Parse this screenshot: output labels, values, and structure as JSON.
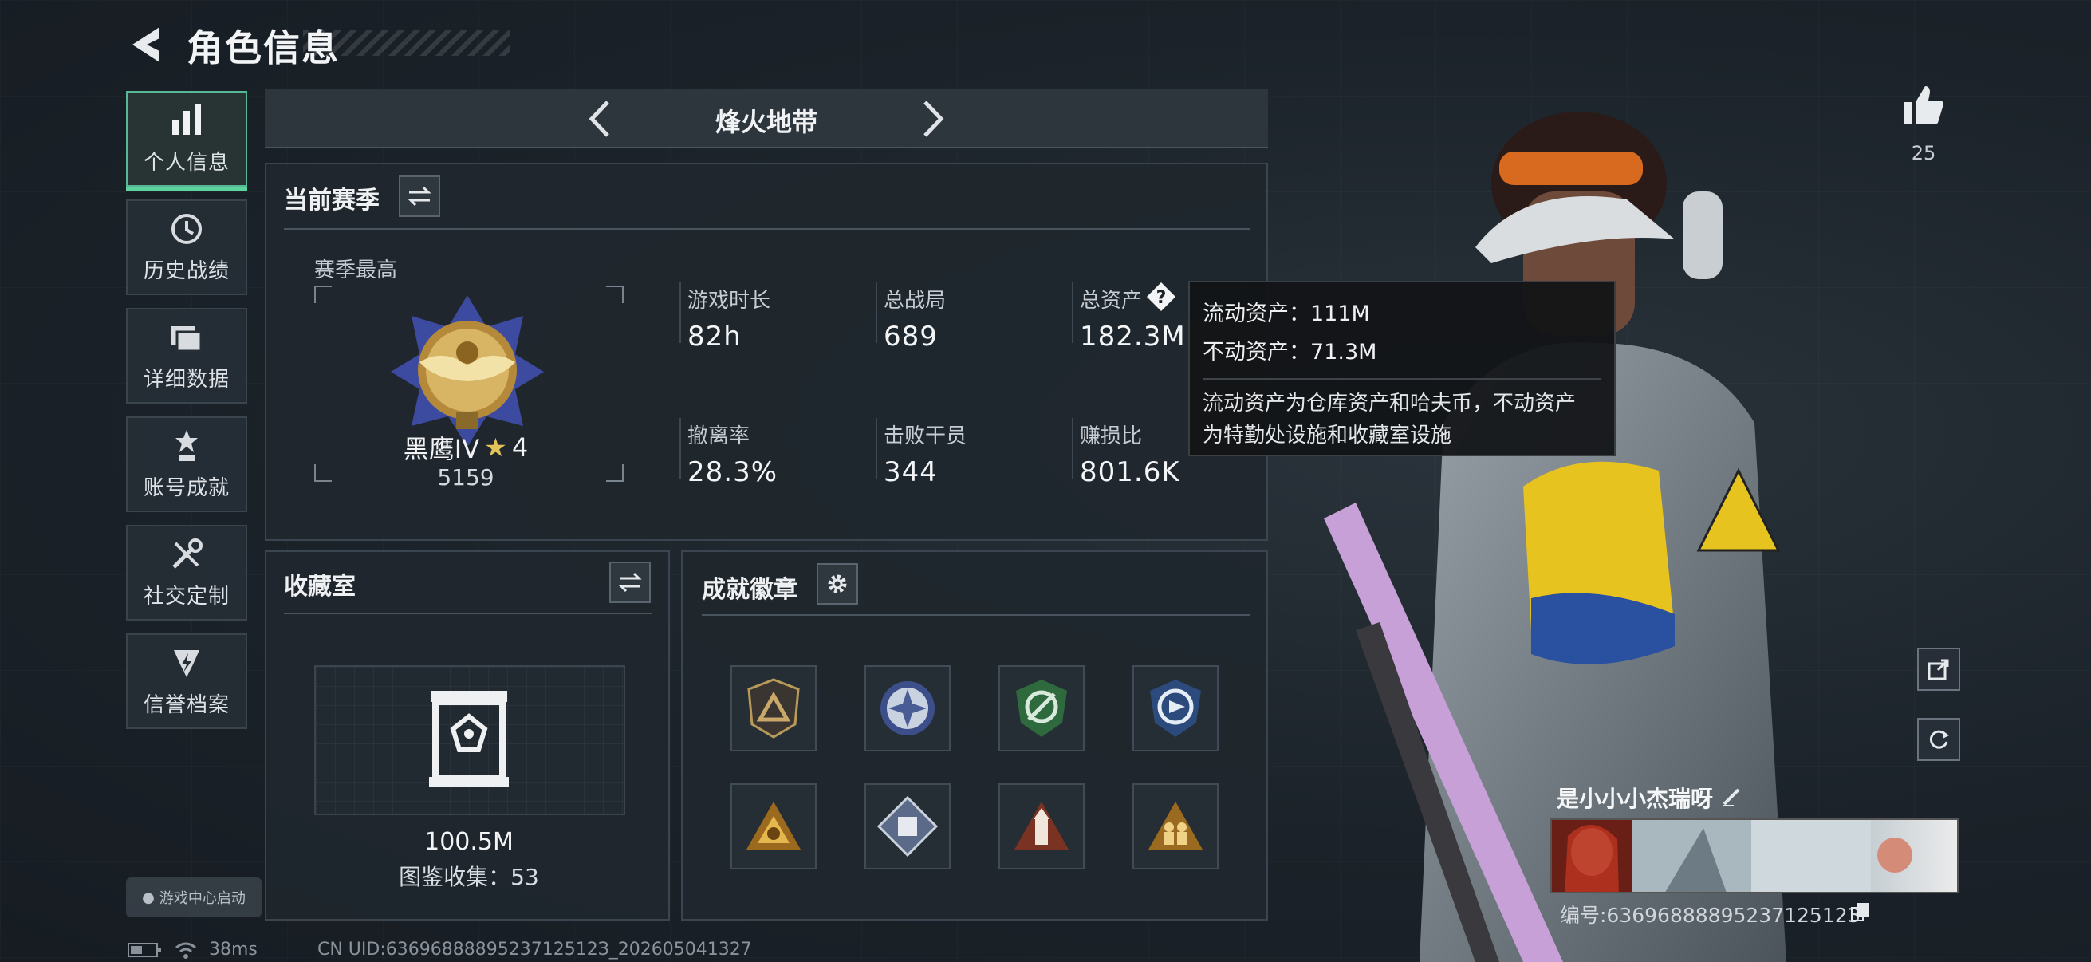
{
  "header": {
    "title": "角色信息"
  },
  "sidebar": {
    "items": [
      {
        "label": "个人信息",
        "icon": "bar-chart-icon",
        "active": true
      },
      {
        "label": "历史战绩",
        "icon": "history-icon",
        "active": false
      },
      {
        "label": "详细数据",
        "icon": "folders-icon",
        "active": false
      },
      {
        "label": "账号成就",
        "icon": "achievement-icon",
        "active": false
      },
      {
        "label": "社交定制",
        "icon": "tools-icon",
        "active": false
      },
      {
        "label": "信誉档案",
        "icon": "shield-bolt-icon",
        "active": false
      }
    ],
    "launch_chip": "游戏中心启动"
  },
  "mode": {
    "name": "烽火地带"
  },
  "season": {
    "title": "当前赛季",
    "best_label": "赛季最高",
    "rank_name": "黑鹰IV",
    "rank_stars": "4",
    "rank_points": "5159",
    "stats": [
      {
        "label": "游戏时长",
        "value": "82h"
      },
      {
        "label": "总战局",
        "value": "689"
      },
      {
        "label": "总资产",
        "value": "182.3M"
      },
      {
        "label": "撤离率",
        "value": "28.3%"
      },
      {
        "label": "击败干员",
        "value": "344"
      },
      {
        "label": "赚损比",
        "value": "801.6K"
      }
    ]
  },
  "tooltip": {
    "liquid": "流动资产：111M",
    "fixed": "不动资产：71.3M",
    "note_line1": "流动资产为仓库资产和哈夫币，不动资产",
    "note_line2": "为特勤处设施和收藏室设施"
  },
  "collection": {
    "title": "收藏室",
    "value": "100.5M",
    "catalog": "图鉴收集：53"
  },
  "achievements": {
    "title": "成就徽章",
    "badges": [
      {
        "icon": "triangle-shield-badge-icon"
      },
      {
        "icon": "star-compass-badge-icon"
      },
      {
        "icon": "green-crest-badge-icon"
      },
      {
        "icon": "blue-arrow-badge-icon"
      },
      {
        "icon": "gold-triangle-badge-icon"
      },
      {
        "icon": "diamond-badge-icon"
      },
      {
        "icon": "tower-badge-icon"
      },
      {
        "icon": "soldiers-badge-icon"
      }
    ]
  },
  "profile": {
    "likes": "25",
    "name": "是小小小杰瑞呀",
    "id_text": "编号:6369688889523712512З"
  },
  "status": {
    "latency": "38ms",
    "uid": "CN UID:6369688889523712512З_202605041327"
  },
  "colors": {
    "accent": "#5dd39e",
    "panel": "#20272e",
    "border": "#3b454f"
  }
}
